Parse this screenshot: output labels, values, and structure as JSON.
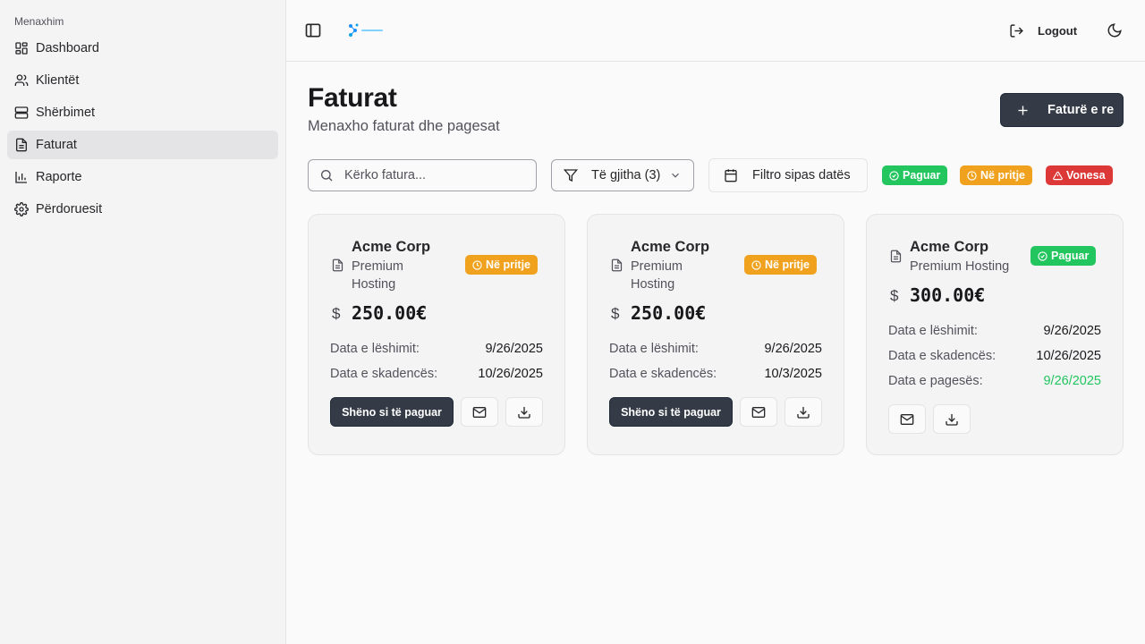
{
  "sidebar": {
    "group_label": "Menaxhim",
    "items": [
      {
        "label": "Dashboard",
        "icon": "dashboard-icon"
      },
      {
        "label": "Klientët",
        "icon": "users-icon"
      },
      {
        "label": "Shërbimet",
        "icon": "server-icon"
      },
      {
        "label": "Faturat",
        "icon": "file-text-icon",
        "active": true
      },
      {
        "label": "Raporte",
        "icon": "bar-chart-icon"
      },
      {
        "label": "Përdoruesit",
        "icon": "gear-icon"
      }
    ]
  },
  "header": {
    "logout_label": "Logout"
  },
  "page": {
    "title": "Faturat",
    "subtitle": "Menaxho faturat dhe pagesat",
    "new_button": "Faturë e re"
  },
  "toolbar": {
    "search_placeholder": "Kërko fatura...",
    "filter_value": "Të gjitha (3)",
    "date_filter_label": "Filtro sipas datës",
    "legend": {
      "paid": "Paguar",
      "pending": "Në pritje",
      "late": "Vonesa"
    }
  },
  "colors": {
    "paid": "#22c55e",
    "pending": "#f0a21e",
    "late": "#dc3838",
    "primary": "#343a46"
  },
  "invoices": [
    {
      "client": "Acme Corp",
      "service": "Premium Hosting",
      "status": "Në pritje",
      "currency_symbol": "$",
      "amount": "250.00€",
      "issue_label": "Data e lëshimit:",
      "issue_date": "9/26/2025",
      "due_label": "Data e skadencës:",
      "due_date": "10/26/2025",
      "mark_paid_label": "Shëno si të paguar"
    },
    {
      "client": "Acme Corp",
      "service": "Premium Hosting",
      "status": "Në pritje",
      "currency_symbol": "$",
      "amount": "250.00€",
      "issue_label": "Data e lëshimit:",
      "issue_date": "9/26/2025",
      "due_label": "Data e skadencës:",
      "due_date": "10/3/2025",
      "mark_paid_label": "Shëno si të paguar"
    },
    {
      "client": "Acme Corp",
      "service": "Premium Hosting",
      "status": "Paguar",
      "currency_symbol": "$",
      "amount": "300.00€",
      "issue_label": "Data e lëshimit:",
      "issue_date": "9/26/2025",
      "due_label": "Data e skadencës:",
      "due_date": "10/26/2025",
      "paid_label": "Data e pagesës:",
      "paid_date": "9/26/2025"
    }
  ]
}
